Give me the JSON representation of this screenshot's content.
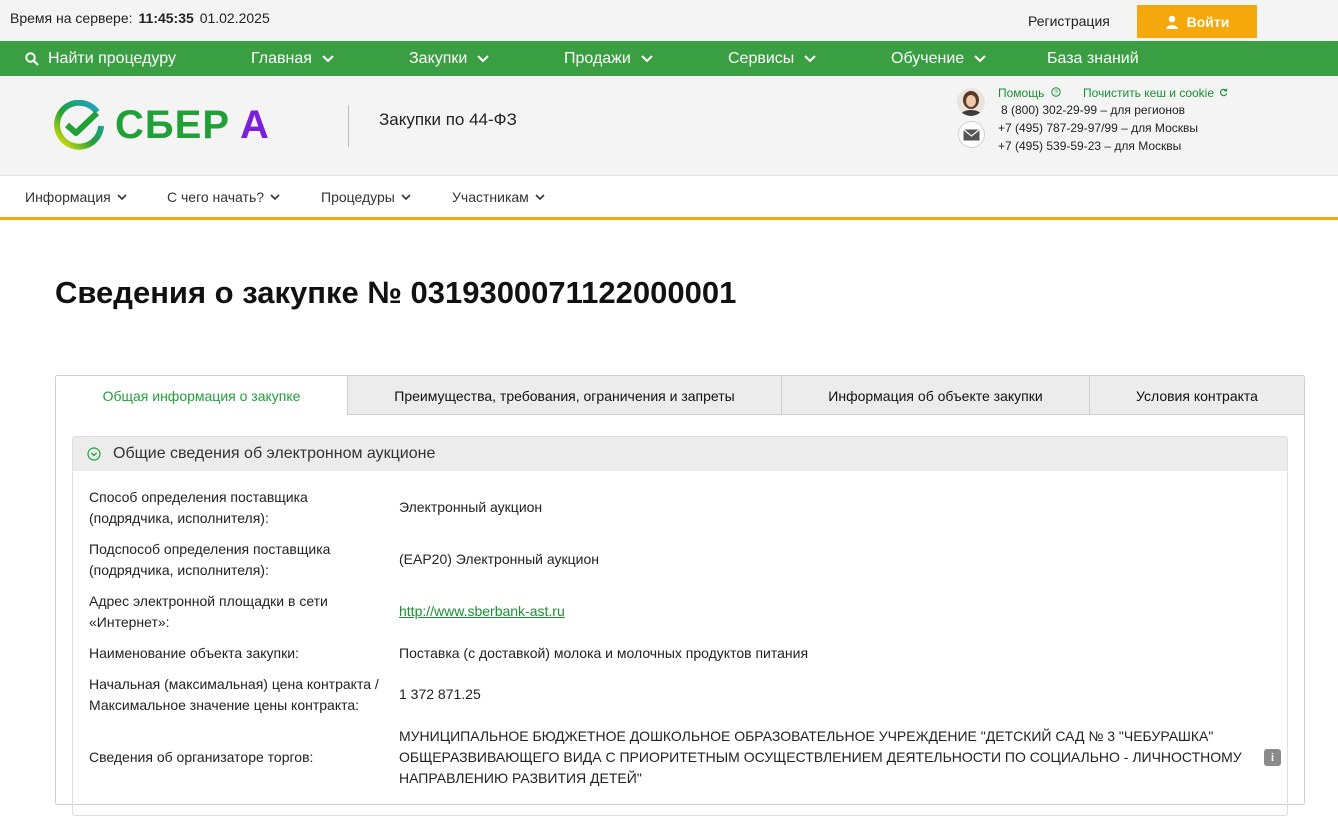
{
  "topbar": {
    "server_time_label": "Время на сервере:",
    "server_clock": "11:45:35",
    "server_date": "01.02.2025",
    "register": "Регистрация",
    "login": "Войти"
  },
  "green_nav": {
    "search": "Найти процедуру",
    "items": [
      "Главная",
      "Закупки",
      "Продажи",
      "Сервисы",
      "Обучение",
      "База знаний"
    ]
  },
  "header": {
    "logo_text": "СБЕР",
    "logo_letter": "А",
    "subtitle": "Закупки по 44-ФЗ",
    "help": "Помощь",
    "clear_cache": "Почистить кеш и cookie",
    "phones": [
      "8 (800) 302-29-99 – для регионов",
      "+7 (495) 787-29-97/99 – для Москвы",
      "+7 (495) 539-59-23 – для Москвы"
    ]
  },
  "sub_nav": {
    "items": [
      "Информация",
      "С чего начать?",
      "Процедуры",
      "Участникам"
    ]
  },
  "page": {
    "title": "Сведения о закупке № 0319300071122000001"
  },
  "tabs": [
    "Общая информация о закупке",
    "Преимущества, требования, ограничения и запреты",
    "Информация об объекте закупки",
    "Условия контракта"
  ],
  "panel": {
    "title": "Общие сведения об электронном аукционе",
    "rows": [
      {
        "label": "Способ определения поставщика (подрядчика, исполнителя):",
        "value": "Электронный аукцион"
      },
      {
        "label": "Подспособ определения поставщика (подрядчика, исполнителя):",
        "value": "(ЕАР20) Электронный аукцион"
      },
      {
        "label": "Адрес электронной площадки в сети «Интернет»:",
        "value": "http://www.sberbank-ast.ru"
      },
      {
        "label": "Наименование объекта закупки:",
        "value": "Поставка (с доставкой) молока и молочных продуктов питания"
      },
      {
        "label": "Начальная (максимальная) цена контракта / Максимальное значение цены контракта:",
        "value": "1 372 871.25"
      },
      {
        "label": "Сведения об организаторе торгов:",
        "value": "МУНИЦИПАЛЬНОЕ БЮДЖЕТНОЕ ДОШКОЛЬНОЕ ОБРАЗОВАТЕЛЬНОЕ УЧРЕЖДЕНИЕ \"ДЕТСКИЙ САД № 3 \"ЧЕБУРАШКА\" ОБЩЕРАЗВИВАЮЩЕГО ВИДА С ПРИОРИТЕТНЫМ ОСУЩЕСТВЛЕНИЕМ ДЕЯТЕЛЬНОСТИ ПО СОЦИАЛЬНО - ЛИЧНОСТНОМУ НАПРАВЛЕНИЮ РАЗВИТИЯ ДЕТЕЙ\""
      }
    ],
    "info_icon": "i"
  },
  "colors": {
    "green": "#3a9f42",
    "accent_orange": "#f5a80c",
    "sber_green": "#21a038",
    "logo_purple": "#7b1fdc"
  }
}
